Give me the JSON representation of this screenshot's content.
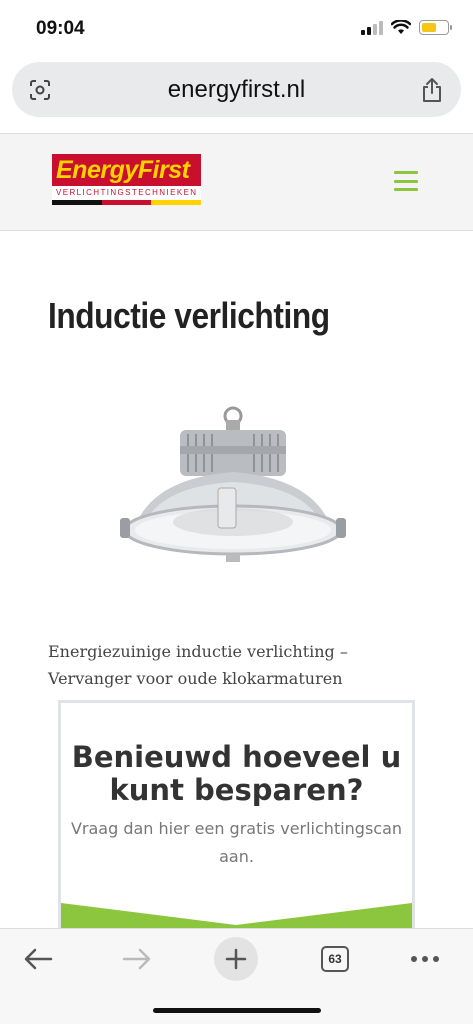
{
  "status": {
    "time": "09:04",
    "battery_color": "#f5c518"
  },
  "browser": {
    "url": "energyfirst.nl",
    "left_icon": "screenshot-lens-icon",
    "right_icon": "share-icon"
  },
  "site": {
    "logo_main": "EnergyFirst",
    "logo_sub": "VERLICHTINGSTECHNIEKEN",
    "brand_red": "#c8102e",
    "brand_yellow": "#ffd200",
    "accent_green": "#8cc63f",
    "menu_icon": "hamburger-icon"
  },
  "main": {
    "title": "Inductie verlichting",
    "intro": "Energiezuinige inductie verlichting – Vervanger voor oude klokarmaturen"
  },
  "cta": {
    "title": "Benieuwd hoeveel u kunt besparen?",
    "subtitle": "Vraag dan hier een gratis verlichtingscan aan."
  },
  "toolbar": {
    "back_icon": "arrow-left-icon",
    "forward_icon": "arrow-right-icon",
    "new_tab_icon": "plus-icon",
    "tab_count": "63",
    "more_icon": "more-dots-icon"
  }
}
